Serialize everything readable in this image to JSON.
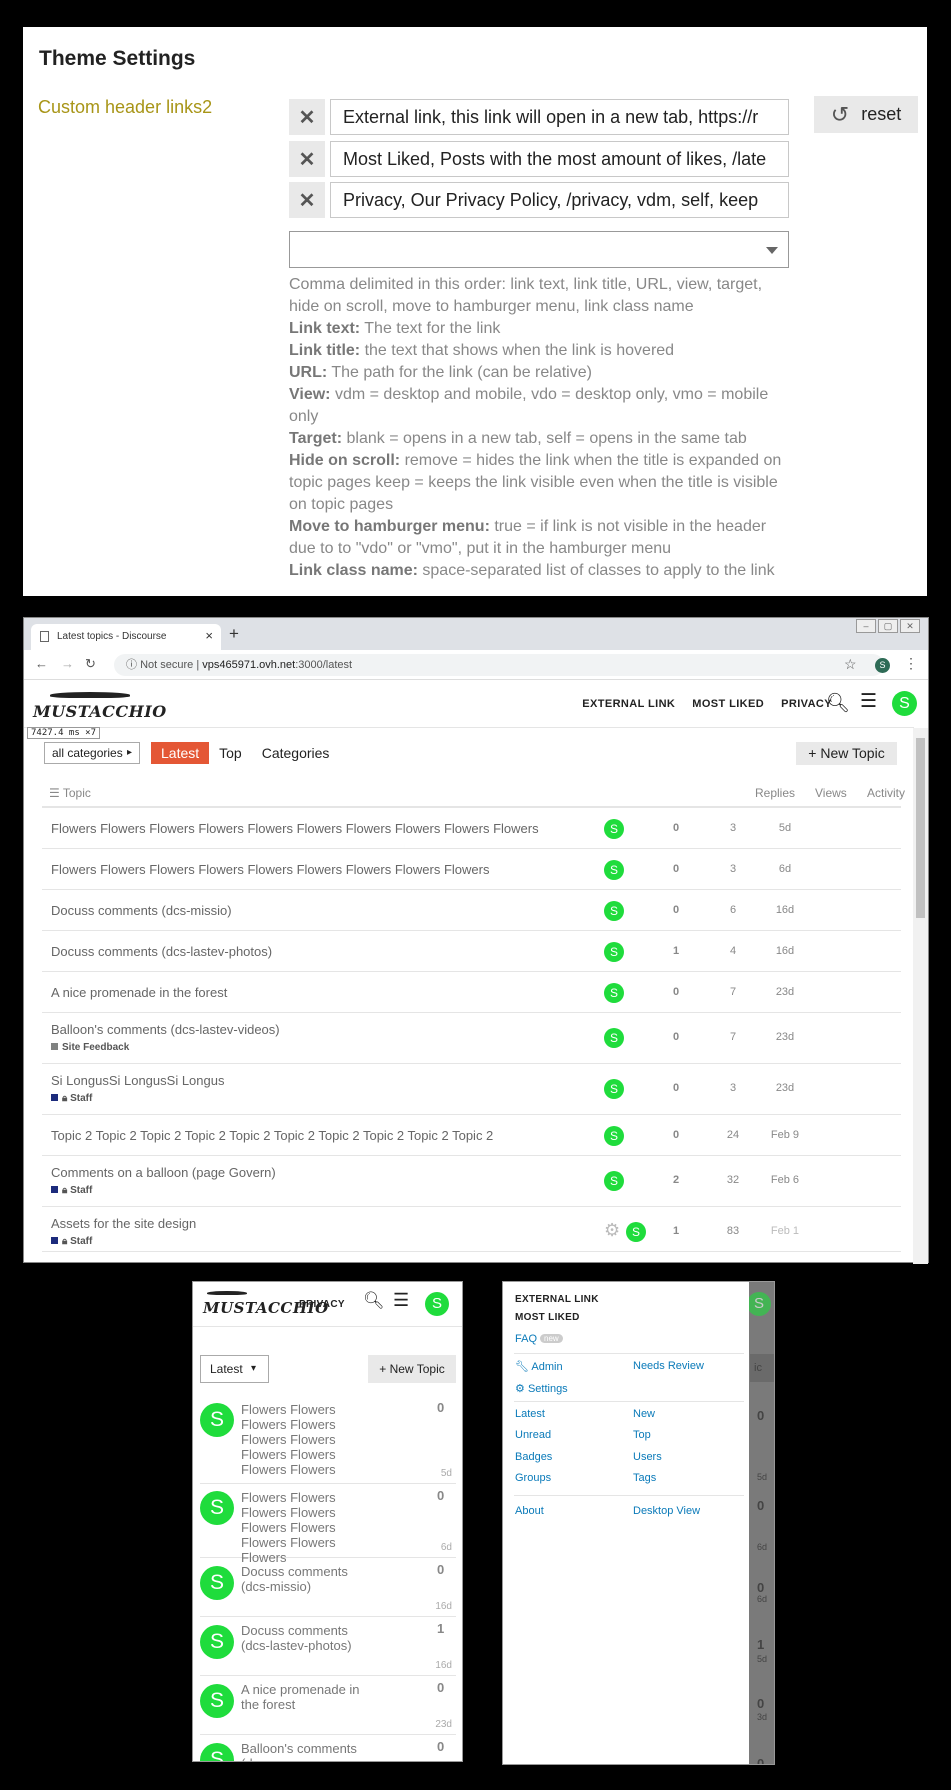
{
  "theme": {
    "title": "Theme Settings",
    "setting_label": "Custom header links2",
    "values": [
      "External link, this link will open in a new tab, https://r",
      "Most Liked, Posts with the most amount of likes, /late",
      "Privacy, Our Privacy Policy, /privacy, vdm, self, keep"
    ],
    "remove_glyph": "✕",
    "reset_label": "reset",
    "reset_icon": "↺",
    "description_intro": "Comma delimited in this order: link text, link title, URL, view, target, hide on scroll, move to hamburger menu, link class name",
    "description_items": [
      {
        "term": "Link text:",
        "text": "The text for the link"
      },
      {
        "term": "Link title:",
        "text": "the text that shows when the link is hovered"
      },
      {
        "term": "URL:",
        "text": "The path for the link (can be relative)"
      },
      {
        "term": "View:",
        "text": "vdm = desktop and mobile, vdo = desktop only, vmo = mobile only"
      },
      {
        "term": "Target:",
        "text": "blank = opens in a new tab, self = opens in the same tab"
      },
      {
        "term": "Hide on scroll:",
        "text": "remove = hides the link when the title is expanded on topic pages keep = keeps the link visible even when the title is visible on topic pages"
      },
      {
        "term": "Move to hamburger menu:",
        "text": "true = if link is not visible in the header due to to \"vdo\" or \"vmo\", put it in the hamburger menu"
      },
      {
        "term": "Link class name:",
        "text": "space-separated list of classes to apply to the link"
      }
    ]
  },
  "browser": {
    "tab_title": "Latest topics - Discourse",
    "tab_close": "×",
    "new_tab": "+",
    "not_secure": "Not secure",
    "url_host": "vps465971.ovh.net",
    "url_path": ":3000/latest",
    "profile_letter": "S",
    "perf_badge": "7427.4 ms ×7"
  },
  "discourse": {
    "logo_text": "MUSTACCHIO",
    "header_links": [
      "EXTERNAL LINK",
      "MOST LIKED",
      "PRIVACY"
    ],
    "avatar_letter": "S",
    "category_filter": "all categories",
    "nav": [
      "Latest",
      "Top",
      "Categories"
    ],
    "new_topic": "+ New Topic",
    "columns": {
      "topic": "☰ Topic",
      "replies": "Replies",
      "views": "Views",
      "activity": "Activity"
    },
    "topics": [
      {
        "title": "Flowers Flowers Flowers Flowers Flowers Flowers Flowers Flowers Flowers Flowers",
        "category": "",
        "replies": "0",
        "views": "3",
        "activity": "5d",
        "gear": false
      },
      {
        "title": "Flowers Flowers Flowers Flowers Flowers Flowers Flowers Flowers Flowers",
        "category": "",
        "replies": "0",
        "views": "3",
        "activity": "6d",
        "gear": false
      },
      {
        "title": "Docuss comments (dcs-missio)",
        "category": "",
        "replies": "0",
        "views": "6",
        "activity": "16d",
        "gear": false
      },
      {
        "title": "Docuss comments (dcs-lastev-photos)",
        "category": "",
        "replies": "1",
        "views": "4",
        "activity": "16d",
        "gear": false
      },
      {
        "title": "A nice promenade in the forest",
        "category": "",
        "replies": "0",
        "views": "7",
        "activity": "23d",
        "gear": false
      },
      {
        "title": "Balloon's comments (dcs-lastev-videos)",
        "category": "Site Feedback",
        "replies": "0",
        "views": "7",
        "activity": "23d",
        "gear": false
      },
      {
        "title": "Si LongusSi LongusSi Longus",
        "category": "Staff",
        "replies": "0",
        "views": "3",
        "activity": "23d",
        "gear": false
      },
      {
        "title": "Topic 2 Topic 2 Topic 2 Topic 2 Topic 2 Topic 2 Topic 2 Topic 2 Topic 2 Topic 2",
        "category": "",
        "replies": "0",
        "views": "24",
        "activity": "Feb 9",
        "gear": false
      },
      {
        "title": "Comments on a balloon (page Govern)",
        "category": "Staff",
        "replies": "2",
        "views": "32",
        "activity": "Feb 6",
        "gear": false
      },
      {
        "title": "Assets for the site design",
        "category": "Staff",
        "replies": "1",
        "views": "83",
        "activity": "Feb 1",
        "gear": true
      }
    ],
    "colors": {
      "accent": "#e45735",
      "avatar": "#1fdc3c",
      "link": "#0a7ab9",
      "setting_label": "#a89517"
    }
  },
  "mobile": {
    "header_link": "PRIVACY",
    "filter": "Latest",
    "new_topic": "+ New Topic",
    "topics": [
      {
        "title": "Flowers Flowers Flowers Flowers Flowers Flowers Flowers Flowers Flowers Flowers",
        "replies": "0",
        "time": "5d"
      },
      {
        "title": "Flowers Flowers Flowers Flowers Flowers Flowers Flowers Flowers Flowers",
        "replies": "0",
        "time": "6d"
      },
      {
        "title": "Docuss comments (dcs-missio)",
        "replies": "0",
        "time": "16d"
      },
      {
        "title": "Docuss comments (dcs-lastev-photos)",
        "replies": "1",
        "time": "16d"
      },
      {
        "title": "A nice promenade in the forest",
        "replies": "0",
        "time": "23d"
      },
      {
        "title": "Balloon's comments (dcs-",
        "replies": "0",
        "time": ""
      }
    ]
  },
  "menu": {
    "header_links": [
      "EXTERNAL LINK",
      "MOST LIKED"
    ],
    "faq": "FAQ",
    "faq_badge": "new",
    "admin": "Admin",
    "needs_review": "Needs Review",
    "settings": "Settings",
    "links_left": [
      "Latest",
      "Unread",
      "Badges",
      "Groups"
    ],
    "links_right": [
      "New",
      "Top",
      "Users",
      "Tags"
    ],
    "about": "About",
    "desktop_view": "Desktop View",
    "background_counts": [
      "0",
      "0",
      "0",
      "1",
      "0",
      "0"
    ],
    "background_times": [
      "5d",
      "6d",
      "6d",
      "5d",
      "3d"
    ],
    "background_btn": "ic"
  }
}
